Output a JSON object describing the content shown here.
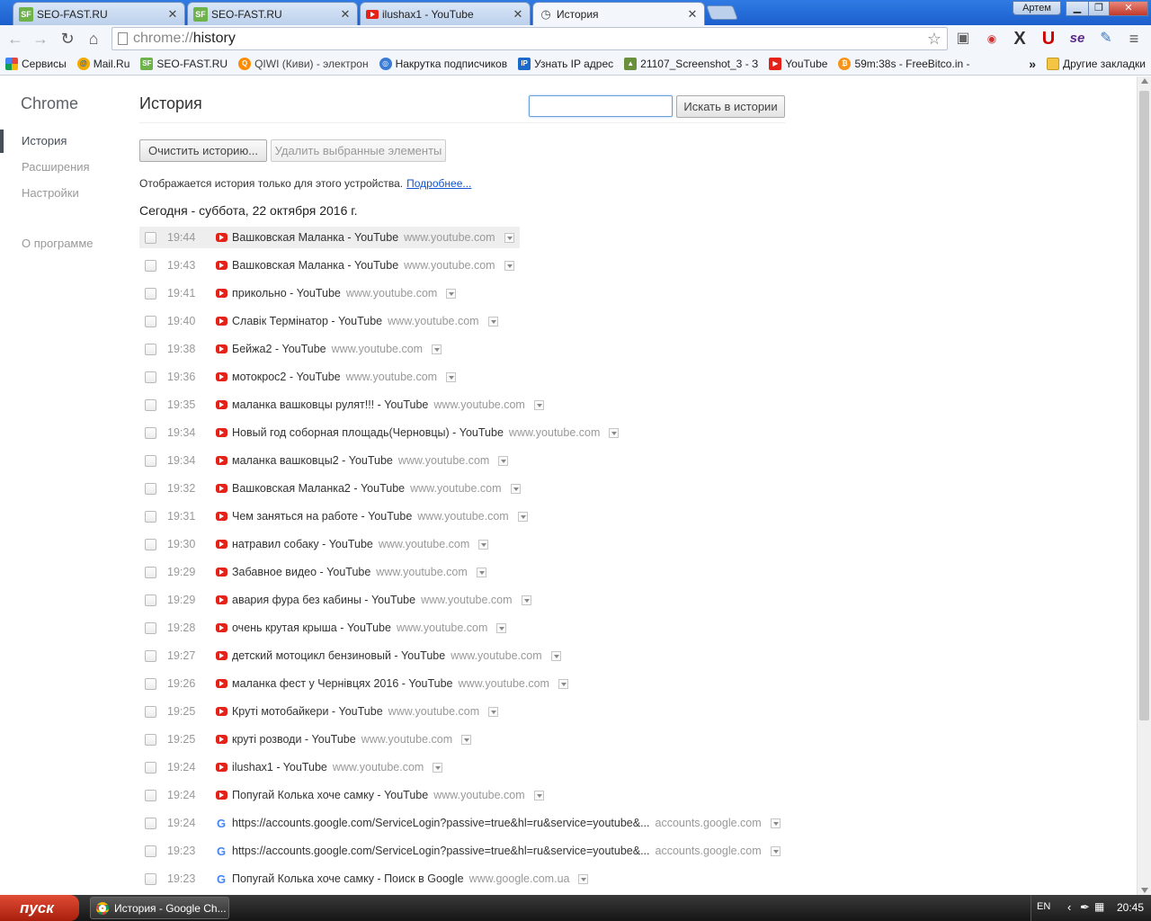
{
  "tabs": [
    {
      "label": "SEO-FAST.RU",
      "icon": "sf-favicon"
    },
    {
      "label": "SEO-FAST.RU",
      "icon": "sf-favicon"
    },
    {
      "label": "ilushax1 - YouTube",
      "icon": "youtube-favicon"
    },
    {
      "label": "История",
      "icon": "history-icon",
      "active": true
    }
  ],
  "window": {
    "user": "Артем"
  },
  "omnibox": {
    "scheme": "chrome://",
    "host": "history"
  },
  "bookmarks": [
    {
      "label": "Сервисы",
      "color": "#e8453c"
    },
    {
      "label": "Mail.Ru",
      "color": "#1a62c6"
    },
    {
      "label": "SEO-FAST.RU",
      "color": "#6db34a"
    },
    {
      "label": "QIWI (Киви) - электрон",
      "color": "#ff8c00"
    },
    {
      "label": "Накрутка подписчиков",
      "color": "#3a7bd5"
    },
    {
      "label": "Узнать IP адрес",
      "color": "#1b6ac9"
    },
    {
      "label": "21107_Screenshot_3 - З",
      "color": "#6a8f3d"
    },
    {
      "label": "YouTube",
      "color": "#e62117"
    },
    {
      "label": "59m:38s - FreeBitco.in -",
      "color": "#f7931a"
    }
  ],
  "bookmarks_overflow": "»",
  "bookmarks_other": "Другие закладки",
  "sidebar": {
    "brand": "Chrome",
    "items": [
      "История",
      "Расширения",
      "Настройки"
    ],
    "about": "О программе"
  },
  "main": {
    "title": "История",
    "search_button": "Искать в истории",
    "clear_button": "Очистить историю...",
    "delete_button": "Удалить выбранные элементы",
    "info": "Отображается история только для этого устройства.",
    "info_link": "Подробнее...",
    "day_header": "Сегодня - суббота, 22 октября 2016 г."
  },
  "entries": [
    {
      "time": "19:44",
      "title": "Вашковская Маланка - YouTube",
      "domain": "www.youtube.com",
      "icon": "yt"
    },
    {
      "time": "19:43",
      "title": "Вашковская Маланка - YouTube",
      "domain": "www.youtube.com",
      "icon": "yt"
    },
    {
      "time": "19:41",
      "title": "прикольно - YouTube",
      "domain": "www.youtube.com",
      "icon": "yt"
    },
    {
      "time": "19:40",
      "title": "Славік Термінатор - YouTube",
      "domain": "www.youtube.com",
      "icon": "yt"
    },
    {
      "time": "19:38",
      "title": "Бейжа2 - YouTube",
      "domain": "www.youtube.com",
      "icon": "yt"
    },
    {
      "time": "19:36",
      "title": "мотокрос2 - YouTube",
      "domain": "www.youtube.com",
      "icon": "yt"
    },
    {
      "time": "19:35",
      "title": "маланка вашковцы рулят!!! - YouTube",
      "domain": "www.youtube.com",
      "icon": "yt"
    },
    {
      "time": "19:34",
      "title": "Новый год соборная площадь(Черновцы) - YouTube",
      "domain": "www.youtube.com",
      "icon": "yt"
    },
    {
      "time": "19:34",
      "title": "маланка вашковцы2 - YouTube",
      "domain": "www.youtube.com",
      "icon": "yt"
    },
    {
      "time": "19:32",
      "title": "Вашковская Маланка2 - YouTube",
      "domain": "www.youtube.com",
      "icon": "yt"
    },
    {
      "time": "19:31",
      "title": "Чем заняться на работе - YouTube",
      "domain": "www.youtube.com",
      "icon": "yt"
    },
    {
      "time": "19:30",
      "title": "натравил собаку - YouTube",
      "domain": "www.youtube.com",
      "icon": "yt"
    },
    {
      "time": "19:29",
      "title": "Забавное видео - YouTube",
      "domain": "www.youtube.com",
      "icon": "yt"
    },
    {
      "time": "19:29",
      "title": "авария фура без кабины - YouTube",
      "domain": "www.youtube.com",
      "icon": "yt"
    },
    {
      "time": "19:28",
      "title": "очень крутая крыша - YouTube",
      "domain": "www.youtube.com",
      "icon": "yt"
    },
    {
      "time": "19:27",
      "title": "детский мотоцикл бензиновый - YouTube",
      "domain": "www.youtube.com",
      "icon": "yt"
    },
    {
      "time": "19:26",
      "title": "маланка фест у Чернівцях 2016 - YouTube",
      "domain": "www.youtube.com",
      "icon": "yt"
    },
    {
      "time": "19:25",
      "title": "Круті мотобайкери - YouTube",
      "domain": "www.youtube.com",
      "icon": "yt"
    },
    {
      "time": "19:25",
      "title": "круті розводи - YouTube",
      "domain": "www.youtube.com",
      "icon": "yt"
    },
    {
      "time": "19:24",
      "title": "ilushax1 - YouTube",
      "domain": "www.youtube.com",
      "icon": "yt"
    },
    {
      "time": "19:24",
      "title": "Попугай Колька хоче самку - YouTube",
      "domain": "www.youtube.com",
      "icon": "yt"
    },
    {
      "time": "19:24",
      "title": "https://accounts.google.com/ServiceLogin?passive=true&hl=ru&service=youtube&...",
      "domain": "accounts.google.com",
      "icon": "g"
    },
    {
      "time": "19:23",
      "title": "https://accounts.google.com/ServiceLogin?passive=true&hl=ru&service=youtube&...",
      "domain": "accounts.google.com",
      "icon": "g"
    },
    {
      "time": "19:23",
      "title": "Попугай Колька хоче самку - Поиск в Google",
      "domain": "www.google.com.ua",
      "icon": "g"
    }
  ],
  "taskbar": {
    "start": "пуск",
    "task": "История - Google Ch...",
    "lang": "EN",
    "clock": "20:45"
  }
}
